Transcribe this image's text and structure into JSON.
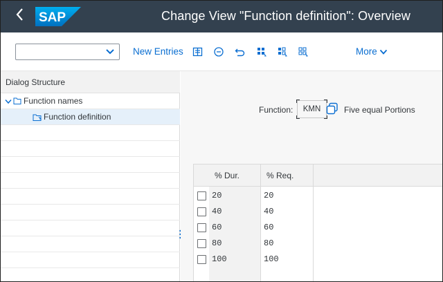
{
  "shell": {
    "logo_text": "SAP",
    "title": "Change View \"Function definition\": Overview",
    "brand_color": "#0a6ed1",
    "header_color": "#33414f"
  },
  "toolbar": {
    "select_value": "",
    "new_entries_label": "New Entries",
    "more_label": "More",
    "icons": [
      "details-icon",
      "delete-icon",
      "undo-icon",
      "select-all-icon",
      "select-block-icon",
      "deselect-all-icon"
    ]
  },
  "dialog_structure": {
    "header": "Dialog Structure",
    "items": [
      {
        "label": "Function names",
        "expanded": true,
        "selected": false
      },
      {
        "label": "Function definition",
        "expanded": false,
        "selected": true
      }
    ]
  },
  "function_header": {
    "label": "Function:",
    "value": "KMN",
    "description": "Five equal Portions"
  },
  "table": {
    "columns": [
      "% Dur.",
      "% Req."
    ],
    "rows": [
      {
        "dur": "20",
        "req": "20"
      },
      {
        "dur": "40",
        "req": "40"
      },
      {
        "dur": "60",
        "req": "60"
      },
      {
        "dur": "80",
        "req": "80"
      },
      {
        "dur": "100",
        "req": "100"
      }
    ]
  }
}
